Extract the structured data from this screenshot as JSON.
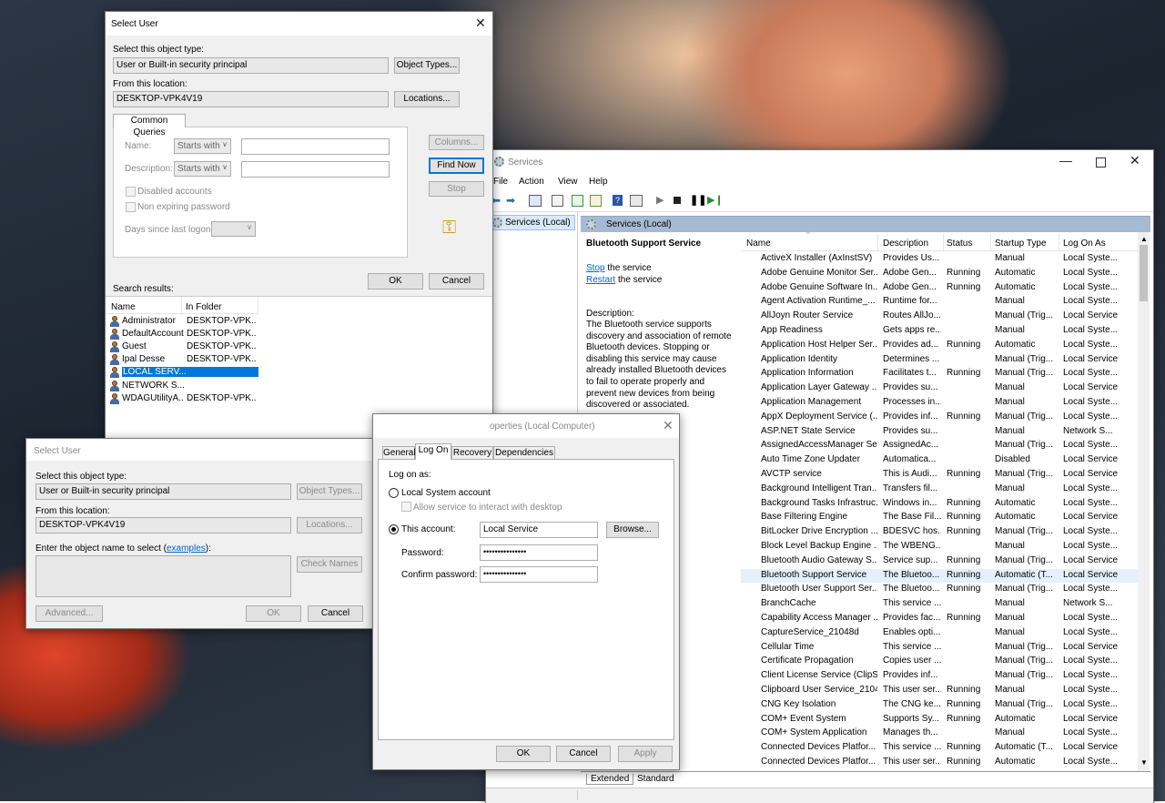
{
  "select_user_1": {
    "title": "Select User",
    "object_type_label": "Select this object type:",
    "object_type_value": "User or Built-in security principal",
    "object_types_button": "Object Types...",
    "location_label": "From this location:",
    "location_value": "DESKTOP-VPK4V19",
    "locations_button": "Locations...",
    "tab_label": "Common Queries",
    "name_label": "Name:",
    "name_mode": "Starts with",
    "description_label": "Description:",
    "description_mode": "Starts with",
    "disabled_accounts": "Disabled accounts",
    "non_expiring": "Non expiring password",
    "days_since_logon": "Days since last logon:",
    "columns_button": "Columns...",
    "find_now_button": "Find Now",
    "stop_button": "Stop",
    "ok_button": "OK",
    "cancel_button": "Cancel",
    "search_results_label": "Search results:",
    "results_columns": [
      "Name",
      "In Folder"
    ],
    "results": [
      {
        "name": "Administrator",
        "folder": "DESKTOP-VPK..."
      },
      {
        "name": "DefaultAccount",
        "folder": "DESKTOP-VPK..."
      },
      {
        "name": "Guest",
        "folder": "DESKTOP-VPK..."
      },
      {
        "name": "Ipal Desse",
        "folder": "DESKTOP-VPK..."
      },
      {
        "name": "LOCAL SERV...",
        "folder": ""
      },
      {
        "name": "NETWORK S...",
        "folder": ""
      },
      {
        "name": "WDAGUtilityA...",
        "folder": "DESKTOP-VPK..."
      }
    ]
  },
  "select_user_2": {
    "title": "Select User",
    "object_type_label": "Select this object type:",
    "object_type_value": "User or Built-in security principal",
    "object_types_button": "Object Types...",
    "location_label": "From this location:",
    "location_value": "DESKTOP-VPK4V19",
    "locations_button": "Locations...",
    "enter_label": "Enter the object name to select",
    "examples_link": "examples",
    "check_names_button": "Check Names",
    "advanced_button": "Advanced...",
    "ok_button": "OK",
    "cancel_button": "Cancel"
  },
  "properties": {
    "title": "operties (Local Computer)",
    "tabs": [
      "General",
      "Log On",
      "Recovery",
      "Dependencies"
    ],
    "log_on_as": "Log on as:",
    "local_system": "Local System account",
    "allow_interact": "Allow service to interact with desktop",
    "this_account": "This account:",
    "account_value": "Local Service",
    "browse_button": "Browse...",
    "password_label": "Password:",
    "password_value": "•••••••••••••••",
    "confirm_label": "Confirm password:",
    "confirm_value": "•••••••••••••••",
    "ok_button": "OK",
    "cancel_button": "Cancel",
    "apply_button": "Apply"
  },
  "services": {
    "title": "Services",
    "menu": [
      "File",
      "Action",
      "View",
      "Help"
    ],
    "tree_item": "Services (Local)",
    "header": "Services (Local)",
    "selected_service": "Bluetooth Support Service",
    "stop_link": "Stop",
    "stop_rest": " the service",
    "restart_link": "Restart",
    "restart_rest": " the service",
    "description_label": "Description:",
    "description_text": "The Bluetooth service supports discovery and association of remote Bluetooth devices.  Stopping or disabling this service may cause already installed Bluetooth devices to fail to operate properly and prevent new devices from being discovered or associated.",
    "columns": [
      "Name",
      "Description",
      "Status",
      "Startup Type",
      "Log On As"
    ],
    "tabs": [
      "Extended",
      "Standard"
    ],
    "rows": [
      [
        "ActiveX Installer (AxInstSV)",
        "Provides Us...",
        "",
        "Manual",
        "Local Syste..."
      ],
      [
        "Adobe Genuine Monitor Ser...",
        "Adobe Gen...",
        "Running",
        "Automatic",
        "Local Syste..."
      ],
      [
        "Adobe Genuine Software In...",
        "Adobe Gen...",
        "Running",
        "Automatic",
        "Local Syste..."
      ],
      [
        "Agent Activation Runtime_...",
        "Runtime for...",
        "",
        "Manual",
        "Local Syste..."
      ],
      [
        "AllJoyn Router Service",
        "Routes AllJo...",
        "",
        "Manual (Trig...",
        "Local Service"
      ],
      [
        "App Readiness",
        "Gets apps re...",
        "",
        "Manual",
        "Local Syste..."
      ],
      [
        "Application Host Helper Ser...",
        "Provides ad...",
        "Running",
        "Automatic",
        "Local Syste..."
      ],
      [
        "Application Identity",
        "Determines ...",
        "",
        "Manual (Trig...",
        "Local Service"
      ],
      [
        "Application Information",
        "Facilitates t...",
        "Running",
        "Manual (Trig...",
        "Local Syste..."
      ],
      [
        "Application Layer Gateway ...",
        "Provides su...",
        "",
        "Manual",
        "Local Service"
      ],
      [
        "Application Management",
        "Processes in...",
        "",
        "Manual",
        "Local Syste..."
      ],
      [
        "AppX Deployment Service (...",
        "Provides inf...",
        "Running",
        "Manual (Trig...",
        "Local Syste..."
      ],
      [
        "ASP.NET State Service",
        "Provides su...",
        "",
        "Manual",
        "Network S..."
      ],
      [
        "AssignedAccessManager Se...",
        "AssignedAc...",
        "",
        "Manual (Trig...",
        "Local Syste..."
      ],
      [
        "Auto Time Zone Updater",
        "Automatica...",
        "",
        "Disabled",
        "Local Service"
      ],
      [
        "AVCTP service",
        "This is Audi...",
        "Running",
        "Manual (Trig...",
        "Local Service"
      ],
      [
        "Background Intelligent Tran...",
        "Transfers fil...",
        "",
        "Manual",
        "Local Syste..."
      ],
      [
        "Background Tasks Infrastruc...",
        "Windows in...",
        "Running",
        "Automatic",
        "Local Syste..."
      ],
      [
        "Base Filtering Engine",
        "The Base Fil...",
        "Running",
        "Automatic",
        "Local Service"
      ],
      [
        "BitLocker Drive Encryption ...",
        "BDESVC hos...",
        "Running",
        "Manual (Trig...",
        "Local Syste..."
      ],
      [
        "Block Level Backup Engine ...",
        "The WBENG...",
        "",
        "Manual",
        "Local Syste..."
      ],
      [
        "Bluetooth Audio Gateway S...",
        "Service sup...",
        "Running",
        "Manual (Trig...",
        "Local Service"
      ],
      [
        "Bluetooth Support Service",
        "The Bluetoo...",
        "Running",
        "Automatic (T...",
        "Local Service"
      ],
      [
        "Bluetooth User Support Ser...",
        "The Bluetoo...",
        "Running",
        "Manual (Trig...",
        "Local Syste..."
      ],
      [
        "BranchCache",
        "This service ...",
        "",
        "Manual",
        "Network S..."
      ],
      [
        "Capability Access Manager ...",
        "Provides fac...",
        "Running",
        "Manual",
        "Local Syste..."
      ],
      [
        "CaptureService_21048d",
        "Enables opti...",
        "",
        "Manual",
        "Local Syste..."
      ],
      [
        "Cellular Time",
        "This service ...",
        "",
        "Manual (Trig...",
        "Local Service"
      ],
      [
        "Certificate Propagation",
        "Copies user ...",
        "",
        "Manual (Trig...",
        "Local Syste..."
      ],
      [
        "Client License Service (ClipS...",
        "Provides inf...",
        "",
        "Manual (Trig...",
        "Local Syste..."
      ],
      [
        "Clipboard User Service_2104...",
        "This user ser...",
        "Running",
        "Manual",
        "Local Syste..."
      ],
      [
        "CNG Key Isolation",
        "The CNG ke...",
        "Running",
        "Manual (Trig...",
        "Local Syste..."
      ],
      [
        "COM+ Event System",
        "Supports Sy...",
        "Running",
        "Automatic",
        "Local Service"
      ],
      [
        "COM+ System Application",
        "Manages th...",
        "",
        "Manual",
        "Local Syste..."
      ],
      [
        "Connected Devices Platfor...",
        "This service ...",
        "Running",
        "Automatic (T...",
        "Local Service"
      ],
      [
        "Connected Devices Platfor...",
        "This user ser...",
        "Running",
        "Automatic",
        "Local Syste..."
      ]
    ]
  }
}
